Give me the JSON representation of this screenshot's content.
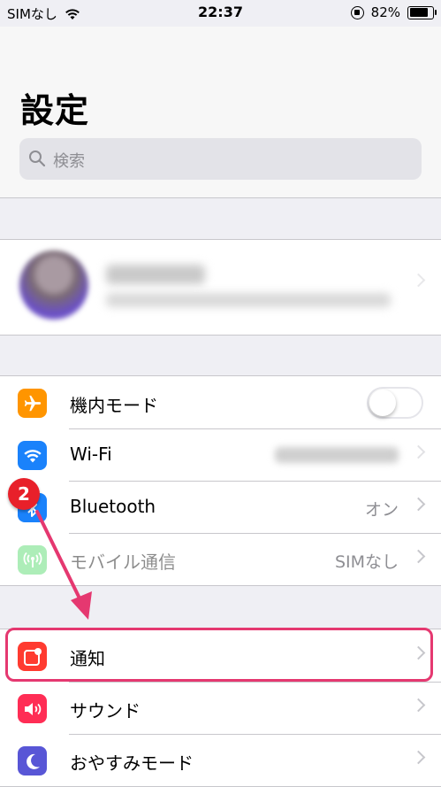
{
  "status_bar": {
    "carrier": "SIMなし",
    "time": "22:37",
    "battery": "82%",
    "battery_level": 0.82
  },
  "header": {
    "title": "設定",
    "search_placeholder": "検索"
  },
  "group1": [
    {
      "label": "機内モード",
      "icon": "airplane-icon",
      "color": "#ff9500",
      "toggle": false
    },
    {
      "label": "Wi-Fi",
      "icon": "wifi-icon",
      "color": "#1a82fb"
    },
    {
      "label": "Bluetooth",
      "icon": "bluetooth-icon",
      "color": "#1a82fb",
      "value": "オン"
    },
    {
      "label": "モバイル通信",
      "icon": "antenna-icon",
      "color": "#4cd964",
      "value": "SIMなし"
    }
  ],
  "group2": [
    {
      "label": "通知",
      "icon": "notifications-icon",
      "color": "#ff3b30"
    },
    {
      "label": "サウンド",
      "icon": "speaker-icon",
      "color": "#ff2d55"
    },
    {
      "label": "おやすみモード",
      "icon": "moon-icon",
      "color": "#5856d6"
    }
  ],
  "annotation": {
    "step": "2",
    "color": "#e53870"
  }
}
